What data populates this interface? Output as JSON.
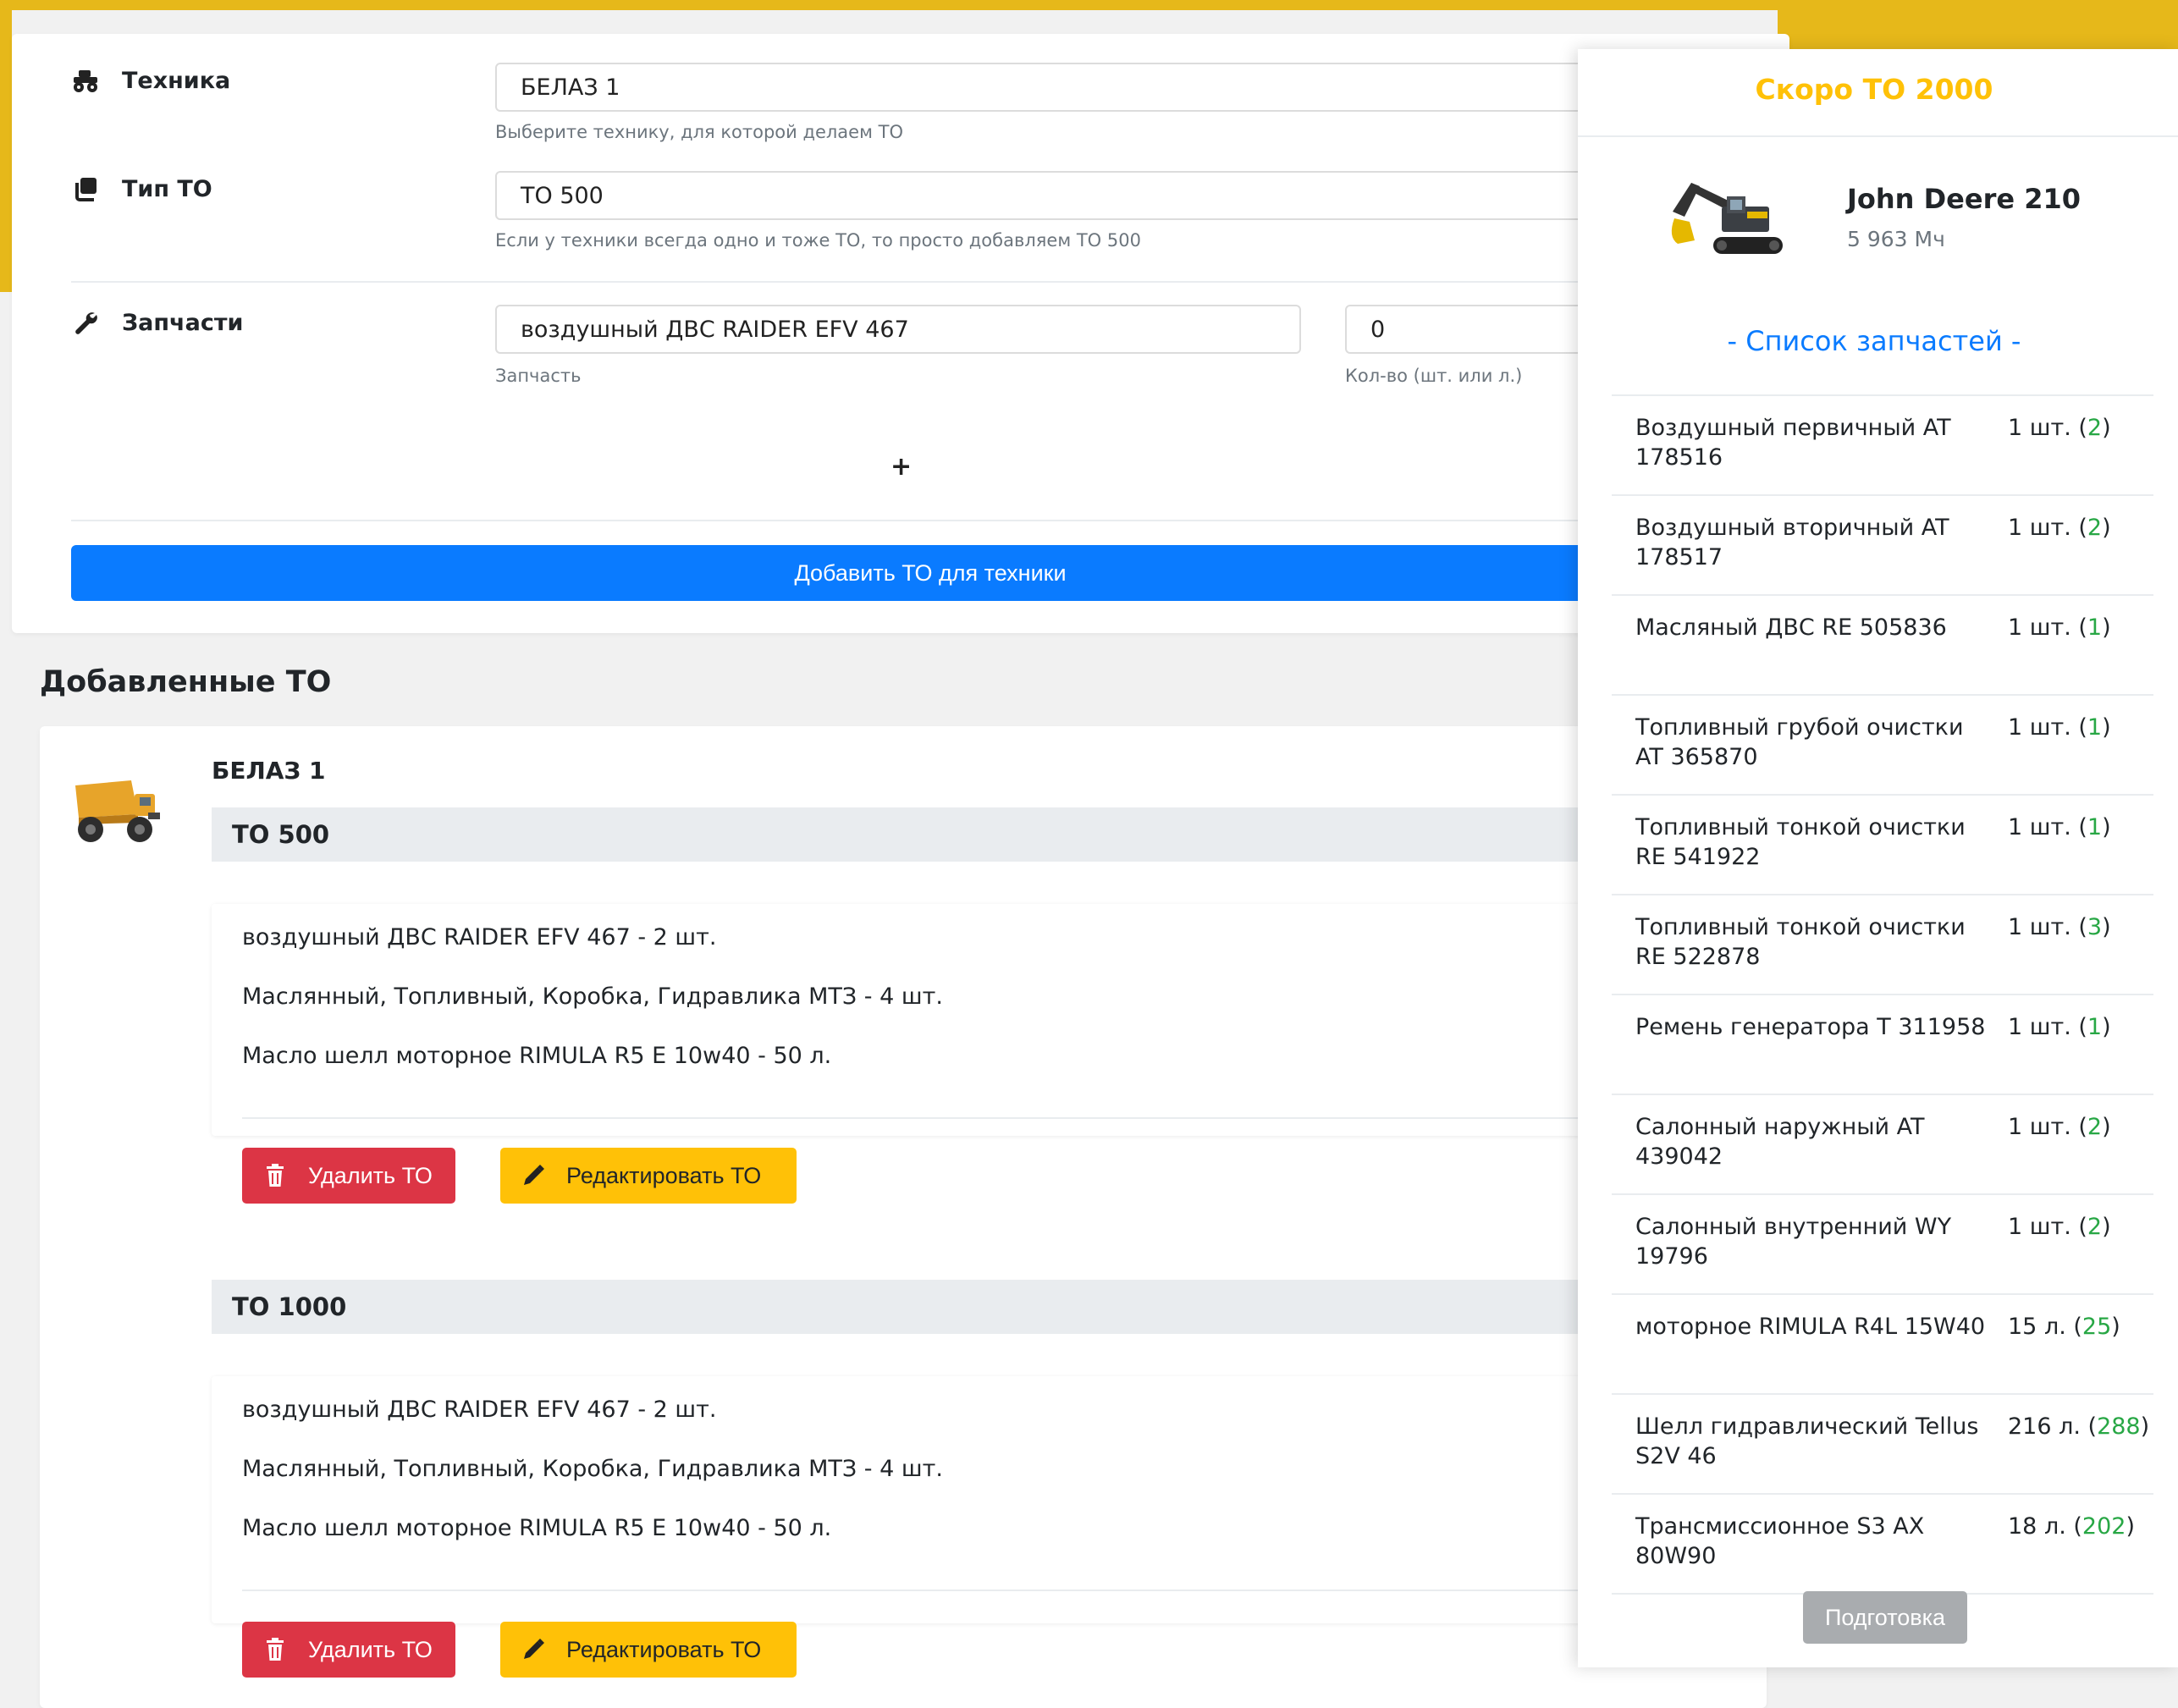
{
  "form": {
    "vehicle": {
      "label": "Техника",
      "value": "БЕЛАЗ 1",
      "hint": "Выберите технику, для которой делаем ТО"
    },
    "to_type": {
      "label": "Тип ТО",
      "value": "ТО 500",
      "hint": "Если у техники всегда одно и тоже ТО, то просто добавляем ТО 500"
    },
    "parts": {
      "label": "Запчасти",
      "part_value": "воздушный ДВС RAIDER EFV 467",
      "part_hint": "Запчасть",
      "qty_value": "0",
      "qty_hint": "Кол-во (шт. или л.)"
    },
    "add_row_label": "+",
    "submit_label": "Добавить ТО для техники"
  },
  "added": {
    "title": "Добавленные ТО",
    "vehicle_name": "БЕЛАЗ 1",
    "items": [
      {
        "name": "ТО 500",
        "lines": [
          "воздушный ДВС RAIDER EFV 467 - 2 шт.",
          "Маслянный, Топливный, Коробка, Гидравлика МТЗ - 4 шт.",
          "Масло шелл моторное RIMULA R5 E 10w40 - 50 л."
        ],
        "delete_label": "Удалить ТО",
        "edit_label": "Редактировать ТО"
      },
      {
        "name": "ТО 1000",
        "lines": [
          "воздушный ДВС RAIDER EFV 467 - 2 шт.",
          "Маслянный, Топливный, Коробка, Гидравлика МТЗ - 4 шт.",
          "Масло шелл моторное RIMULA R5 E 10w40 - 50 л."
        ],
        "delete_label": "Удалить ТО",
        "edit_label": "Редактировать ТО"
      }
    ]
  },
  "panel": {
    "title": "Скоро ТО 2000",
    "machine_name": "John Deere 210",
    "machine_hours": "5 963 Мч",
    "parts_link": "- Список запчастей -",
    "parts": [
      {
        "name": "Воздушный первичный AT 178516",
        "qty": "1 шт. (",
        "have": "2",
        "close": ")"
      },
      {
        "name": "Воздушный вторичный AT 178517",
        "qty": "1 шт. (",
        "have": "2",
        "close": ")"
      },
      {
        "name": "Масляный ДВС RE 505836",
        "qty": "1 шт. (",
        "have": "1",
        "close": ")"
      },
      {
        "name": "Топливный грубой очистки AT 365870",
        "qty": "1 шт. (",
        "have": "1",
        "close": ")"
      },
      {
        "name": "Топливный тонкой очистки RE 541922",
        "qty": "1 шт. (",
        "have": "1",
        "close": ")"
      },
      {
        "name": "Топливный тонкой очистки RE 522878",
        "qty": "1 шт. (",
        "have": "3",
        "close": ")"
      },
      {
        "name": "Ремень генератора T 311958",
        "qty": "1 шт. (",
        "have": "1",
        "close": ")"
      },
      {
        "name": "Салонный наружный AT 439042",
        "qty": "1 шт. (",
        "have": "2",
        "close": ")"
      },
      {
        "name": "Салонный внутренний WY 19796",
        "qty": "1 шт. (",
        "have": "2",
        "close": ")"
      },
      {
        "name": "моторное RIMULA R4L 15W40",
        "qty": "15 л. (",
        "have": "25",
        "close": ")"
      },
      {
        "name": "Шелл гидравлический Tellus S2V 46",
        "qty": "216 л. (",
        "have": "288",
        "close": ")"
      },
      {
        "name": "Трансмиссионное S3 AX 80W90",
        "qty": "18 л. (",
        "have": "202",
        "close": ")"
      }
    ],
    "prep_label": "Подготовка"
  },
  "colors": {
    "primary": "#0a7bff",
    "danger": "#dc3545",
    "warning": "#ffc107",
    "success": "#28a745",
    "accent_yellow": "#e6b81a"
  },
  "icons": {
    "vehicle": "monster-truck-icon",
    "to_type": "clone-icon",
    "parts": "wrench-icon",
    "delete": "trash-icon",
    "edit": "pen-icon"
  }
}
